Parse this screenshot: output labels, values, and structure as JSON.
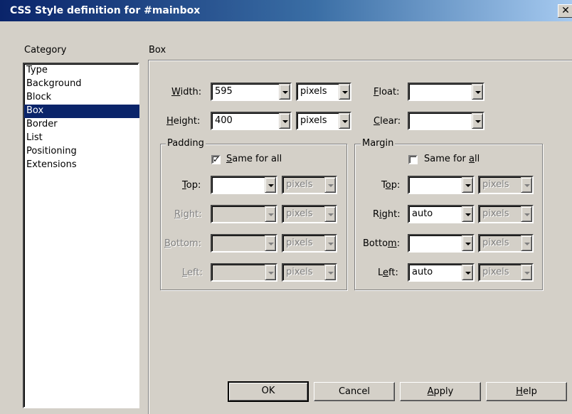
{
  "window": {
    "title": "CSS Style definition for #mainbox",
    "close_glyph": "✕"
  },
  "category": {
    "label": "Category",
    "items": [
      "Type",
      "Background",
      "Block",
      "Box",
      "Border",
      "List",
      "Positioning",
      "Extensions"
    ],
    "selected": "Box"
  },
  "section": {
    "title": "Box"
  },
  "width": {
    "label": "Width:",
    "value": "595",
    "unit": "pixels"
  },
  "height": {
    "label": "Height:",
    "value": "400",
    "unit": "pixels"
  },
  "float": {
    "label": "Float:",
    "value": ""
  },
  "clear": {
    "label": "Clear:",
    "value": ""
  },
  "padding": {
    "legend": "Padding",
    "same_for_all": {
      "label": "Same for all",
      "checked": true
    },
    "rows": [
      {
        "label": "Top:",
        "value": "",
        "unit": "pixels"
      },
      {
        "label": "Right:",
        "value": "",
        "unit": "pixels"
      },
      {
        "label": "Bottom:",
        "value": "",
        "unit": "pixels"
      },
      {
        "label": "Left:",
        "value": "",
        "unit": "pixels"
      }
    ]
  },
  "margin": {
    "legend": "Margin",
    "same_for_all": {
      "label": "Same for all",
      "checked": false
    },
    "rows": [
      {
        "label": "Top:",
        "value": "",
        "unit": "pixels"
      },
      {
        "label": "Right:",
        "value": "auto",
        "unit": "pixels"
      },
      {
        "label": "Bottom:",
        "value": "",
        "unit": "pixels"
      },
      {
        "label": "Left:",
        "value": "auto",
        "unit": "pixels"
      }
    ]
  },
  "buttons": {
    "ok": "OK",
    "cancel": "Cancel",
    "apply": "Apply",
    "help": "Help"
  },
  "colors": {
    "title_bar": "#0a246a",
    "selection": "#0a246a",
    "face": "#d4d0c8"
  }
}
